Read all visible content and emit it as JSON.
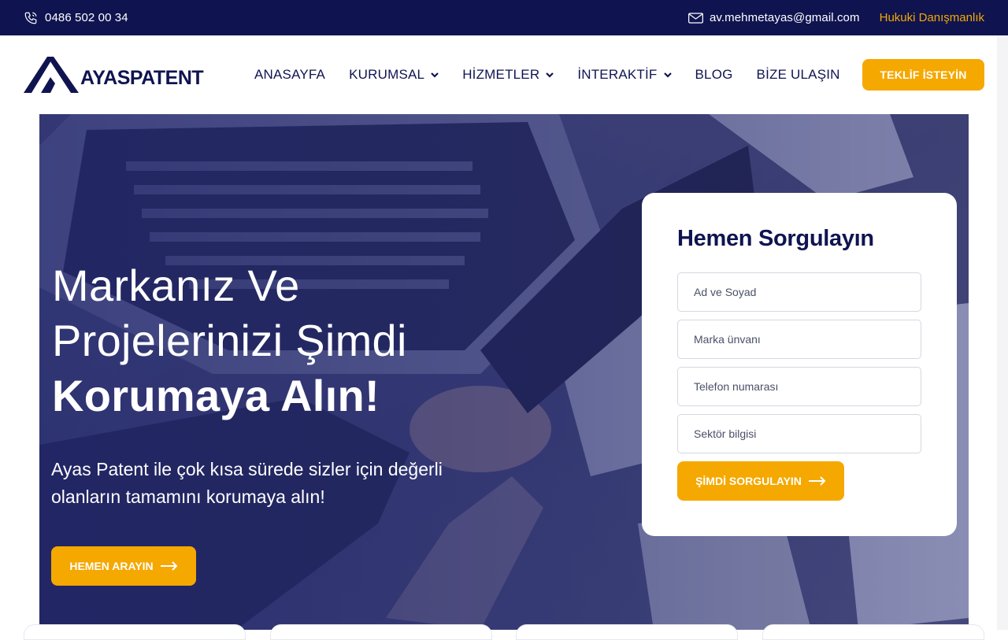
{
  "topbar": {
    "phone": "0486 502 00 34",
    "email": "av.mehmetayas@gmail.com",
    "link": "Hukuki Danışmanlık"
  },
  "header": {
    "logo_text": "AYASPATENT",
    "nav": [
      {
        "label": "ANASAYFA",
        "dropdown": false
      },
      {
        "label": "KURUMSAL",
        "dropdown": true
      },
      {
        "label": "HİZMETLER",
        "dropdown": true
      },
      {
        "label": "İNTERAKTİF",
        "dropdown": true
      },
      {
        "label": "BLOG",
        "dropdown": false
      },
      {
        "label": "BİZE ULAŞIN",
        "dropdown": false
      }
    ],
    "cta": "TEKLİF İSTEYİN"
  },
  "hero": {
    "title_line1": "Markanız Ve",
    "title_line2": "Projelerinizi Şimdi",
    "title_line3": "Korumaya Alın!",
    "subtitle": "Ayas Patent ile çok kısa sürede sizler için değerli olanların tamamını korumaya alın!",
    "button": "HEMEN ARAYIN"
  },
  "form": {
    "title": "Hemen Sorgulayın",
    "fields": [
      {
        "placeholder": "Ad ve Soyad",
        "value": ""
      },
      {
        "placeholder": "Marka ünvanı",
        "value": ""
      },
      {
        "placeholder": "Telefon numarası",
        "value": ""
      },
      {
        "placeholder": "Sektör bilgisi",
        "value": ""
      }
    ],
    "submit": "ŞİMDİ SORGULAYIN"
  },
  "colors": {
    "navy": "#0f1450",
    "accent": "#f5a800"
  }
}
